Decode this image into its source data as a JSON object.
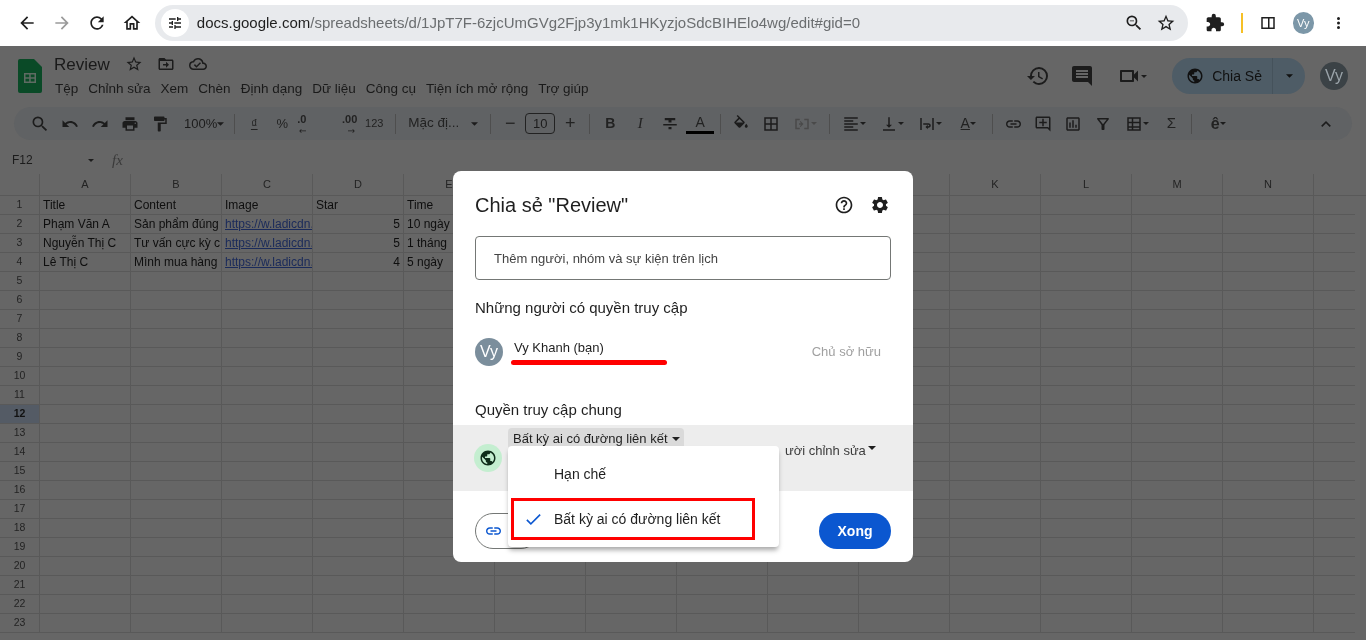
{
  "browser": {
    "url_host": "docs.google.com",
    "url_path": "/spreadsheets/d/1JpT7F-6zjcUmGVg2Fjp3y1mk1HKyzjoSdcBIHElo4wg/edit#gid=0",
    "avatar": "Vy"
  },
  "doc": {
    "title": "Review",
    "menus": [
      "Tệp",
      "Chỉnh sửa",
      "Xem",
      "Chèn",
      "Định dạng",
      "Dữ liệu",
      "Công cụ",
      "Tiện ích mở rộng",
      "Trợ giúp"
    ],
    "share_button": "Chia Sẻ",
    "avatar": "Vy"
  },
  "toolbar": {
    "zoom": "100%",
    "currency": "₫",
    "percent": "%",
    "decrease_decimals": ".0",
    "increase_decimals": ".00",
    "number_format": "123",
    "font": "Mặc đị...",
    "font_size_minus": "−",
    "font_size": "10",
    "font_size_plus": "+",
    "bold": "B",
    "italic": "I",
    "text_color": "A",
    "rotation": "A",
    "sum": "Σ",
    "input_tools": "ê"
  },
  "formula_bar": {
    "cell_ref": "F12",
    "fx": "fx"
  },
  "sheet": {
    "columns_left": [
      "A",
      "B",
      "C",
      "D",
      "E"
    ],
    "columns_right": [
      "K",
      "L",
      "M",
      "N"
    ],
    "rows": [
      {
        "number": "1",
        "selected": false,
        "cells": [
          {
            "text": "Title",
            "kind": "text"
          },
          {
            "text": "Content",
            "kind": "text"
          },
          {
            "text": "Image",
            "kind": "text"
          },
          {
            "text": "Star",
            "kind": "text"
          },
          {
            "text": "Time",
            "kind": "text"
          }
        ]
      },
      {
        "number": "2",
        "selected": false,
        "cells": [
          {
            "text": "Phạm Văn A",
            "kind": "text"
          },
          {
            "text": "Sản phẩm đúng",
            "kind": "text"
          },
          {
            "text": "https://w.ladicdn.",
            "kind": "link"
          },
          {
            "text": "5",
            "kind": "number"
          },
          {
            "text": "10 ngày",
            "kind": "text"
          }
        ]
      },
      {
        "number": "3",
        "selected": false,
        "cells": [
          {
            "text": "Nguyễn Thị C",
            "kind": "text"
          },
          {
            "text": "Tư vấn cực kỳ c",
            "kind": "text"
          },
          {
            "text": "https://w.ladicdn.",
            "kind": "link"
          },
          {
            "text": "5",
            "kind": "number"
          },
          {
            "text": "1 tháng",
            "kind": "text"
          }
        ]
      },
      {
        "number": "4",
        "selected": false,
        "cells": [
          {
            "text": "Lê Thị C",
            "kind": "text"
          },
          {
            "text": "Mình mua hàng",
            "kind": "text"
          },
          {
            "text": "https://w.ladicdn.",
            "kind": "link"
          },
          {
            "text": "4",
            "kind": "number"
          },
          {
            "text": "5 ngày",
            "kind": "text"
          }
        ]
      },
      {
        "number": "5",
        "selected": false
      },
      {
        "number": "6",
        "selected": false
      },
      {
        "number": "7",
        "selected": false
      },
      {
        "number": "8",
        "selected": false
      },
      {
        "number": "9",
        "selected": false
      },
      {
        "number": "10",
        "selected": false
      },
      {
        "number": "11",
        "selected": false
      },
      {
        "number": "12",
        "selected": true
      },
      {
        "number": "13",
        "selected": false
      },
      {
        "number": "14",
        "selected": false
      },
      {
        "number": "15",
        "selected": false
      },
      {
        "number": "16",
        "selected": false
      },
      {
        "number": "17",
        "selected": false
      },
      {
        "number": "18",
        "selected": false
      },
      {
        "number": "19",
        "selected": false
      },
      {
        "number": "20",
        "selected": false
      },
      {
        "number": "21",
        "selected": false
      },
      {
        "number": "22",
        "selected": false
      },
      {
        "number": "23",
        "selected": false
      }
    ]
  },
  "dialog": {
    "title": "Chia sẻ \"Review\"",
    "add_placeholder": "Thêm người, nhóm và sự kiện trên lịch",
    "people_heading": "Những người có quyền truy cập",
    "people": [
      {
        "avatar": "Vy",
        "name": "Vy Khanh (bạn)",
        "role": "Chủ sở hữu",
        "redacted": true
      }
    ],
    "general_heading": "Quyền truy cập chung",
    "general_scope": "Bất kỳ ai có đường liên kết",
    "general_role": "ười chỉnh sửa",
    "access_menu": [
      {
        "label": "Hạn chế",
        "selected": false,
        "highlighted": false
      },
      {
        "label": "Bất kỳ ai có đường liên kết",
        "selected": true,
        "highlighted": true
      }
    ],
    "done_button": "Xong"
  }
}
